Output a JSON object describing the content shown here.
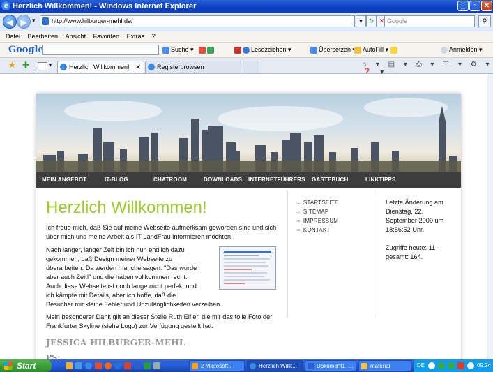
{
  "window": {
    "title": "Herzlich Willkommen! - Windows Internet Explorer",
    "ie_glyph": "e",
    "minimize_glyph": "_",
    "maximize_glyph": "▫",
    "close_glyph": "✕"
  },
  "address": {
    "back_glyph": "◀",
    "forward_glyph": "▶",
    "dropdown_glyph": "▾",
    "url": "http://www.hilburger-mehl.de/",
    "refresh_glyph": "↻",
    "stop_glyph": "✕",
    "search_placeholder": "Google",
    "search_glyph": "⚲"
  },
  "menubar": {
    "items": [
      "Datei",
      "Bearbeiten",
      "Ansicht",
      "Favoriten",
      "Extras",
      "?"
    ]
  },
  "google_toolbar": {
    "logo": "Google",
    "search_button": "Suche",
    "bookmarks": "Lesezeichen",
    "translate": "Übersetzen",
    "autofill": "AutoFill",
    "signin": "Anmelden"
  },
  "tabs": {
    "items": [
      {
        "label": "Herzlich Willkommen!",
        "active": true
      },
      {
        "label": "Registerbrowsen",
        "active": false
      }
    ],
    "close_glyph": "✕"
  },
  "site": {
    "nav": [
      "MEIN ANGEBOT",
      "IT-BLOG",
      "CHATROOM",
      "DOWNLOADS",
      "INTERNETFÜHRERS",
      "GÄSTEBUCH",
      "LINKTIPPS"
    ],
    "heading": "Herzlich Willkommen!",
    "intro": "Ich freue mich, daß Sie auf meine Webseite aufmerksam geworden sind und sich über mich und meine Arbeit als IT-LandFrau informieren möchten.",
    "para_lines": [
      "Nach langer, langer Zeit bin ich nun endlich dazu",
      "gekommen, daß Design meiner Webseite zu",
      "überarbeiten. Da werden manche sagen: \"Das wurde",
      "aber auch Zeit!\" und die haben vollkommen recht.",
      "Auch diese Webseite ist noch lange nicht perfekt und",
      "ich kämpfe mit Details, aber ich hoffe, daß die"
    ],
    "para_tail": "Besucher mir kleine Fehler und Unzulänglichkeiten verzeihen.",
    "thanks": "Mein besonderer Dank gilt an dieser Stelle Ruth Eifler, die mir das tolle Foto der Frankfurter Skyline (siehe Logo) zur Verfügung gestellt hat.",
    "author": "JESSICA HILBURGER-MEHL",
    "ps": "PS:",
    "side_links": [
      "STARTSEITE",
      "SITEMAP",
      "IMPRESSUM",
      "KONTAKT"
    ],
    "updated": "Letzte Änderung am Dienstag, 22. September 2009 um 18:56:52 Uhr.",
    "visits": "Zugriffe heute: 11 - gesamt: 164."
  },
  "taskbar": {
    "start": "Start",
    "tasks": [
      {
        "label": "2 Microsoft...",
        "color": "#f3a21b"
      },
      {
        "label": "Herzlich Willk...",
        "color": "#3a8ae6"
      },
      {
        "label": "Dokument1 -...",
        "color": "#2b5fce"
      },
      {
        "label": "material",
        "color": "#f4c542"
      }
    ],
    "lang": "DE",
    "clock": "09:24"
  },
  "colors": {
    "heading": "#9ecb2e",
    "navbar": "#3e3e3e",
    "titlebar": "#0a3fc2"
  }
}
